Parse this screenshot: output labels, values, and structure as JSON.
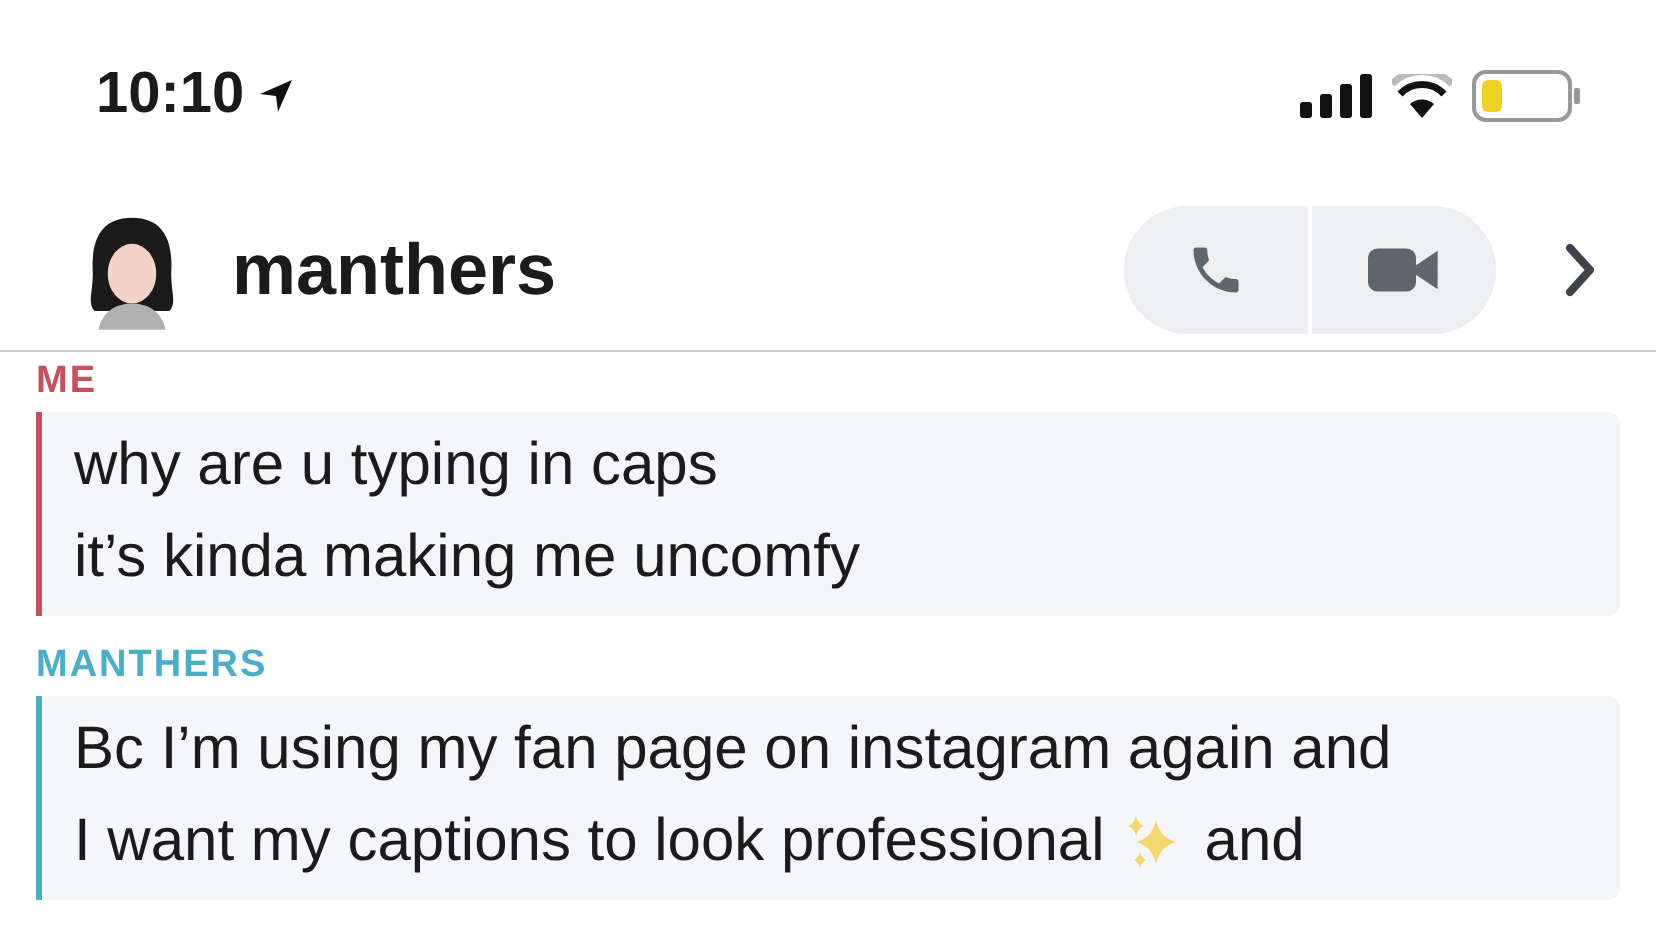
{
  "status_bar": {
    "time": "10:10"
  },
  "header": {
    "name": "manthers"
  },
  "messages": [
    {
      "sender": "ME",
      "color": "#c8505c",
      "lines": [
        {
          "text": "why are u typing in caps"
        },
        {
          "text": "it’s kinda making me uncomfy"
        }
      ]
    },
    {
      "sender": "MANTHERS",
      "color": "#4aaecb",
      "lines": [
        {
          "text": "Bc I’m using my fan page on instagram again and"
        },
        {
          "text": "I want my captions to look professional",
          "sparkles": true,
          "after": "and"
        }
      ]
    }
  ]
}
